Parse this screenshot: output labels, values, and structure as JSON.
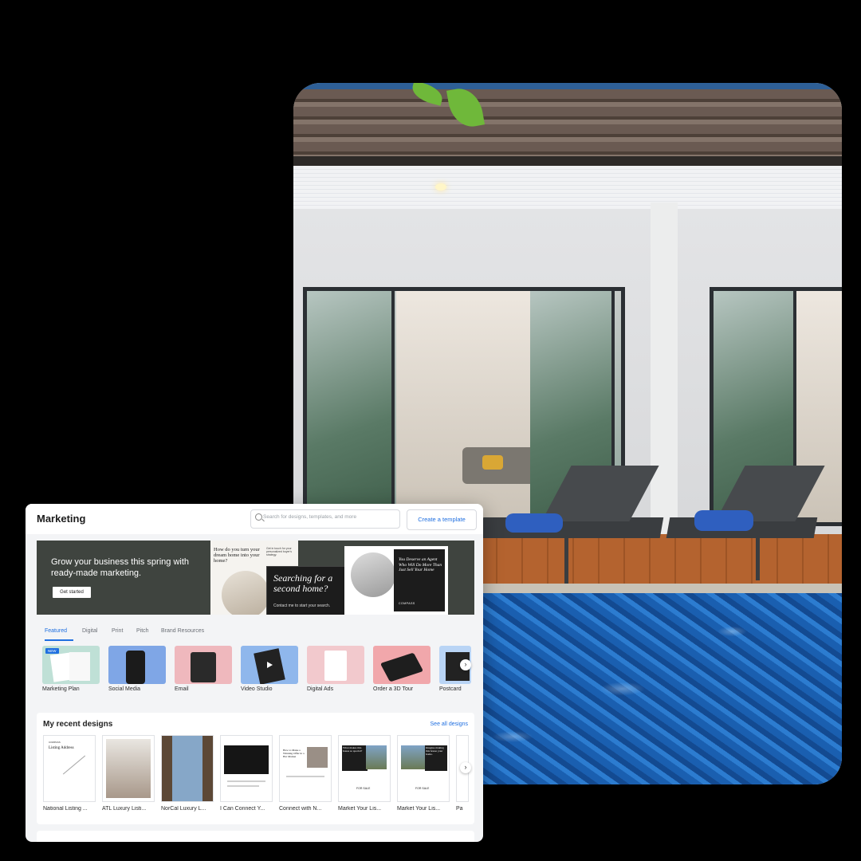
{
  "app": {
    "title": "Marketing",
    "search_placeholder": "Search for designs, templates, and more",
    "create_button": "Create a template"
  },
  "banner": {
    "headline": "Grow your business this spring with ready-made marketing.",
    "cta": "Get started",
    "card1_title": "How do you turn your dream home into your home?",
    "card1_side": "Get in touch for your personalized buyer's strategy.",
    "card2_title": "Searching for a second home?",
    "card2_sub": "Contact me to start your search.",
    "card3_title": "You Deserve an Agent Who Will Do More Than Just Sell Your Home",
    "card3_brand": "COMPASS"
  },
  "tabs": [
    {
      "label": "Featured",
      "active": true
    },
    {
      "label": "Digital",
      "active": false
    },
    {
      "label": "Print",
      "active": false
    },
    {
      "label": "Pitch",
      "active": false
    },
    {
      "label": "Brand Resources",
      "active": false
    }
  ],
  "categories": [
    {
      "label": "Marketing Plan",
      "badge": "NEW",
      "color": "#bfe0d6"
    },
    {
      "label": "Social Media",
      "color": "#7fa6e6"
    },
    {
      "label": "Email",
      "color": "#efb8bd"
    },
    {
      "label": "Video Studio",
      "color": "#8fb7ec"
    },
    {
      "label": "Digital Ads",
      "color": "#f2c9cd"
    },
    {
      "label": "Order a 3D Tour",
      "color": "#f1a7ab"
    },
    {
      "label": "Postcard",
      "color": "#b9d4f5"
    }
  ],
  "recent": {
    "title": "My recent designs",
    "see_all": "See all designs",
    "thumb1_title": "Listing Address",
    "thumb1_brand": "COMPASS",
    "thumb4_title": "How to Make a Winning Offer in a Hot Market",
    "thumb5_title": "What makes this house so special?",
    "thumb5_tag": "FOR SALE",
    "thumb6_title": "Imagine making this house your home.",
    "thumb6_tag": "FOR SALE",
    "items": [
      {
        "label": "National Listing ..."
      },
      {
        "label": "ATL Luxury Listi..."
      },
      {
        "label": "NorCal Luxury L..."
      },
      {
        "label": "I Can Connect Y..."
      },
      {
        "label": "Connect with N..."
      },
      {
        "label": "Market Your Lis..."
      },
      {
        "label": "Market Your Lis..."
      },
      {
        "label": "Pa"
      }
    ]
  },
  "icons": {
    "search": "search-icon",
    "next": "chevron-right-icon"
  },
  "colors": {
    "accent": "#1f6fe0",
    "banner_bg": "#3f443f"
  }
}
